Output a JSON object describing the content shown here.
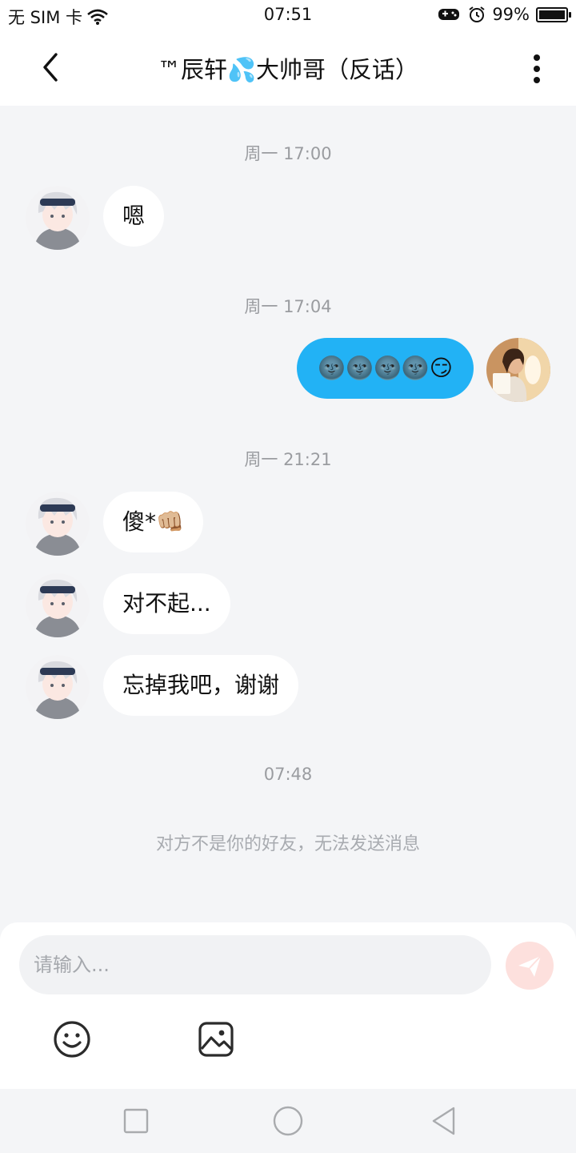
{
  "status_bar": {
    "carrier": "无 SIM 卡",
    "time": "07:51",
    "battery": "99%",
    "battery_level": 0.99
  },
  "header": {
    "title": "™辰轩💦大帅哥（反话）"
  },
  "messages": [
    {
      "timestamp": "周一 17:00"
    },
    {
      "sender": "other",
      "text": "嗯"
    },
    {
      "timestamp": "周一 17:04"
    },
    {
      "sender": "me",
      "text": "🌚🌚🌚🌚😏"
    },
    {
      "timestamp": "周一 21:21"
    },
    {
      "sender": "other",
      "text": "傻*👊🏼"
    },
    {
      "sender": "other",
      "text": "对不起..."
    },
    {
      "sender": "other",
      "text": "忘掉我吧，谢谢"
    },
    {
      "timestamp": "07:48"
    },
    {
      "notice": "对方不是你的好友，无法发送消息"
    }
  ],
  "composer": {
    "placeholder": "请输入..."
  },
  "icons": {
    "back": "chevron-left-icon",
    "more": "more-vertical-icon",
    "send": "send-icon",
    "emoji": "emoji-icon",
    "image": "image-icon",
    "sys_recent": "square-icon",
    "sys_home": "circle-icon",
    "sys_back": "triangle-back-icon"
  },
  "colors": {
    "outgoing_bubble": "#22b2f5",
    "incoming_bubble": "#ffffff",
    "chat_background": "#f4f5f7",
    "send_button": "#fde0dd",
    "send_arrow": "#ffffff"
  }
}
